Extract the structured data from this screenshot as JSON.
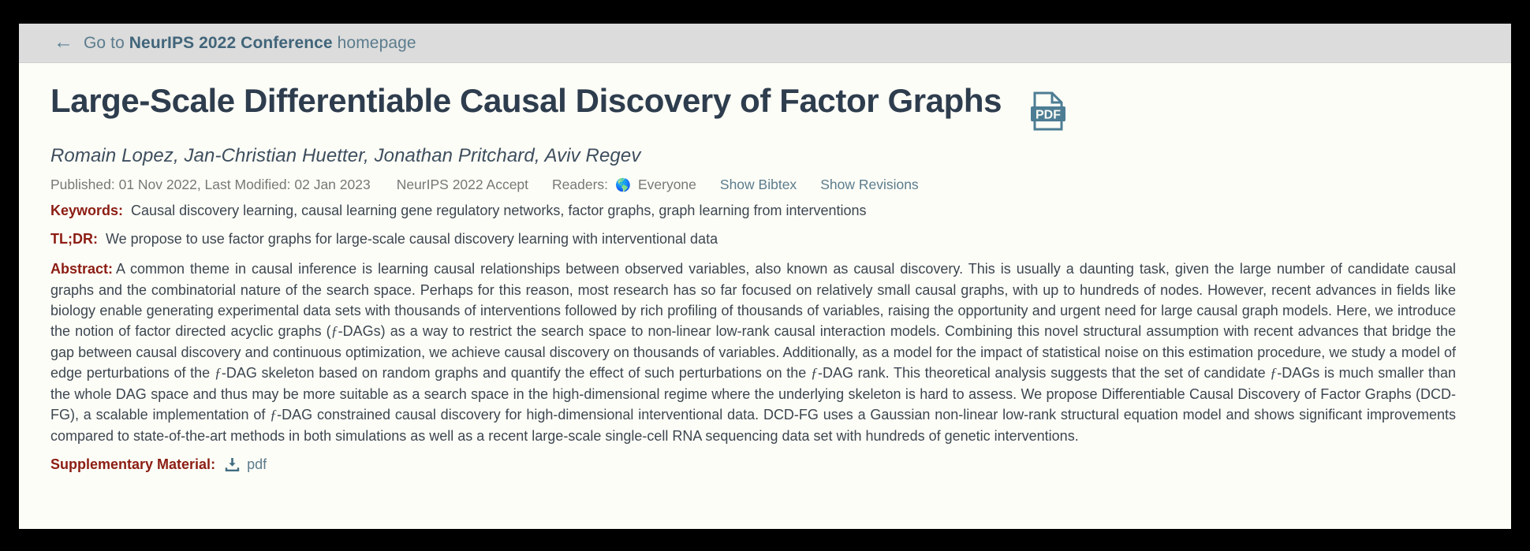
{
  "venue_bar": {
    "back_icon": "left-arrow-icon",
    "prefix": "Go to ",
    "venue": "NeurIPS 2022 Conference",
    "suffix": " homepage"
  },
  "paper": {
    "title": "Large-Scale Differentiable Causal Discovery of Factor Graphs",
    "pdf_icon_label": "PDF",
    "authors": "Romain Lopez, Jan-Christian Huetter, Jonathan Pritchard, Aviv Regev",
    "meta": {
      "published": "Published: 01 Nov 2022, Last Modified: 02 Jan 2023",
      "decision": "NeurIPS 2022 Accept",
      "readers_label": "Readers:",
      "readers_icon": "globe-icon",
      "readers_value": "Everyone",
      "show_bibtex": "Show Bibtex",
      "show_revisions": "Show Revisions"
    },
    "keywords_label": "Keywords:",
    "keywords_value": "Causal discovery learning, causal learning gene regulatory networks, factor graphs, graph learning from interventions",
    "tldr_label": "TL;DR:",
    "tldr_value": "We propose to use factor graphs for large-scale causal discovery learning with interventional data",
    "abstract_label": "Abstract:",
    "abstract_part1": "A common theme in causal inference is learning causal relationships between observed variables, also known as causal discovery. This is usually a daunting task, given the large number of candidate causal graphs and the combinatorial nature of the search space. Perhaps for this reason, most research has so far focused on relatively small causal graphs, with up to hundreds of nodes. However, recent advances in fields like biology enable generating experimental data sets with thousands of interventions followed by rich profiling of thousands of variables, raising the opportunity and urgent need for large causal graph models.  Here, we introduce the notion of factor directed acyclic graphs (",
    "fdag_1": "ƒ",
    "abstract_part2": "-DAGs) as a way to restrict the search space to non-linear low-rank causal interaction models. Combining this novel structural assumption with recent advances that bridge the gap between causal discovery and continuous optimization, we achieve causal discovery on thousands of variables. Additionally, as a model for the impact of statistical noise on this estimation procedure, we study a model of edge perturbations of the ",
    "fdag_2": "ƒ",
    "abstract_part3": "-DAG skeleton based on random graphs and quantify the effect of such perturbations on the ",
    "fdag_3": "ƒ",
    "abstract_part4": "-DAG rank. This theoretical analysis suggests that the set of candidate ",
    "fdag_4": "ƒ",
    "abstract_part5": "-DAGs is much smaller than the whole DAG space and thus may be more suitable as a search space in the high-dimensional regime where the underlying skeleton is hard to assess. We propose Differentiable Causal Discovery of Factor Graphs (DCD-FG), a scalable implementation of ",
    "fdag_5": "ƒ",
    "abstract_part6": "-DAG constrained causal discovery for high-dimensional interventional data. DCD-FG uses a Gaussian non-linear low-rank structural equation model and shows significant improvements compared to state-of-the-art methods in both simulations as well as a recent large-scale single-cell RNA sequencing data set with hundreds of genetic interventions.",
    "supplementary_label": "Supplementary Material:",
    "supplementary_icon": "download-icon",
    "supplementary_link": "pdf"
  },
  "colors": {
    "page_bg": "#fdfdf7",
    "venue_bar_bg": "#dcdcdc",
    "title": "#2e3d4e",
    "link": "#5b7c8d",
    "field_label": "#8c1d13",
    "body_text": "#3c4650",
    "meta_text": "#777777",
    "pdf_icon": "#4d7d94"
  }
}
